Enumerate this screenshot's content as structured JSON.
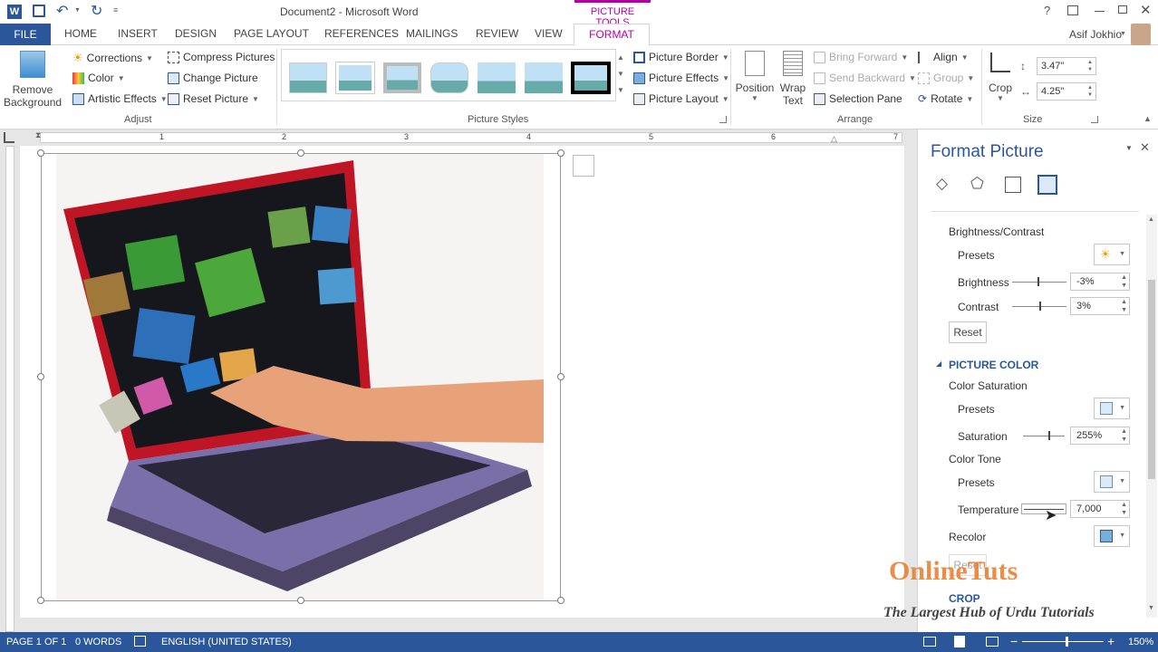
{
  "titlebar": {
    "doc_title": "Document2 - Microsoft Word",
    "context_label": "PICTURE TOOLS",
    "help": "?",
    "user_name": "Asif Jokhio"
  },
  "tabs": [
    "FILE",
    "HOME",
    "INSERT",
    "DESIGN",
    "PAGE LAYOUT",
    "REFERENCES",
    "MAILINGS",
    "REVIEW",
    "VIEW",
    "FORMAT"
  ],
  "ribbon": {
    "adjust": {
      "remove_bg_line1": "Remove",
      "remove_bg_line2": "Background",
      "corrections": "Corrections",
      "color": "Color",
      "artistic": "Artistic Effects",
      "compress": "Compress Pictures",
      "change": "Change Picture",
      "reset": "Reset Picture",
      "label": "Adjust"
    },
    "styles": {
      "label": "Picture Styles"
    },
    "picture": {
      "border": "Picture Border",
      "effects": "Picture Effects",
      "layout": "Picture Layout"
    },
    "arrange": {
      "position": "Position",
      "wrap_line1": "Wrap",
      "wrap_line2": "Text",
      "bring_forward": "Bring Forward",
      "send_backward": "Send Backward",
      "selection_pane": "Selection Pane",
      "align": "Align",
      "group": "Group",
      "rotate": "Rotate",
      "label": "Arrange"
    },
    "size": {
      "crop": "Crop",
      "height": "3.47\"",
      "width": "4.25\"",
      "label": "Size"
    }
  },
  "ruler": {
    "numbers": [
      "1",
      "2",
      "3",
      "4",
      "5",
      "6",
      "7"
    ]
  },
  "pane": {
    "title": "Format Picture",
    "brightness_contrast": "Brightness/Contrast",
    "presets": "Presets",
    "brightness": "Brightness",
    "brightness_value": "-3%",
    "contrast": "Contrast",
    "contrast_value": "3%",
    "reset": "Reset",
    "picture_color": "PICTURE COLOR",
    "color_saturation": "Color Saturation",
    "saturation": "Saturation",
    "saturation_value": "255%",
    "color_tone": "Color Tone",
    "temperature": "Temperature",
    "temperature_value": "7,000",
    "recolor": "Recolor",
    "crop": "CROP"
  },
  "watermark": {
    "brand": "OnlineTuts",
    "tagline": "The Largest Hub of Urdu Tutorials"
  },
  "status": {
    "page": "PAGE 1 OF 1",
    "words": "0 WORDS",
    "language": "ENGLISH (UNITED STATES)",
    "zoom": "150%"
  },
  "colors": {
    "accent": "#2b579a",
    "context": "#b4009e"
  }
}
